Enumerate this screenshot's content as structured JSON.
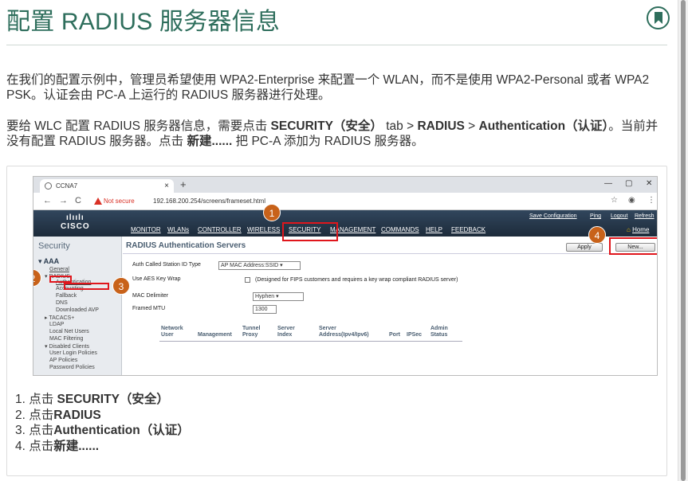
{
  "page": {
    "title": "配置 RADIUS 服务器信息",
    "bookmark_icon": "bookmark-icon"
  },
  "intro": {
    "p1": "在我们的配置示例中，管理员希望使用 WPA2-Enterprise 来配置一个 WLAN，而不是使用 WPA2-Personal 或者 WPA2 PSK。认证会由 PC-A 上运行的 RADIUS 服务器进行处理。",
    "p2_a": "要给 WLC 配置 RADIUS 服务器信息，需要点击 ",
    "p2_security": "SECURITY（安全）",
    "p2_b": " tab > ",
    "p2_radius": "RADIUS",
    "p2_c": " > ",
    "p2_auth": "Authentication（认证）",
    "p2_d": "。当前并没有配置 RADIUS 服务器。点击 ",
    "p2_new": "新建......",
    "p2_e": " 把 PC-A 添加为 RADIUS 服务器。"
  },
  "browser": {
    "tab_title": "CCNA7",
    "tab_close": "×",
    "new_tab": "+",
    "win_min": "—",
    "win_max": "▢",
    "win_close": "✕",
    "back": "←",
    "forward": "→",
    "reload": "C",
    "not_secure": "Not secure",
    "url": "192.168.200.254/screens/frameset.html",
    "star": "☆",
    "account": "◉",
    "more": "⋮"
  },
  "wlc": {
    "logo_top": "ılıılı",
    "logo_bottom": "CISCO",
    "menu": [
      "MONITOR",
      "WLANs",
      "CONTROLLER",
      "WIRELESS",
      "SECURITY",
      "MANAGEMENT",
      "COMMANDS",
      "HELP",
      "FEEDBACK"
    ],
    "top_links": [
      "Save Configuration",
      "Ping",
      "Logout",
      "Refresh"
    ],
    "home": "Home",
    "sidebar_title": "Security",
    "sidebar": {
      "aaa": "▾ AAA",
      "general": "General",
      "radius": "▾ RADIUS",
      "authentication": "Authentication",
      "accounting": "Accounting",
      "fallback": "Fallback",
      "dns": "DNS",
      "downloaded_avp": "Downloaded AVP",
      "tacacs": "▸ TACACS+",
      "ldap": "LDAP",
      "local_net_users": "Local Net Users",
      "mac_filtering": "MAC Filtering",
      "disabled_clients": "▾ Disabled Clients",
      "user_login_policies": "User Login Policies",
      "ap_policies": "AP Policies",
      "password_policies": "Password Policies"
    },
    "content_title": "RADIUS Authentication Servers",
    "apply_label": "Apply",
    "new_label": "New...",
    "auth_called_label": "Auth Called Station ID Type",
    "auth_called_value": "AP MAC Address:SSID ▾",
    "aes_label": "Use AES Key Wrap",
    "aes_note": "(Designed for FIPS customers and requires a key wrap compliant RADIUS server)",
    "mac_delim_label": "MAC Delimiter",
    "mac_delim_value": "Hyphen ▾",
    "mtu_label": "Framed MTU",
    "mtu_value": "1300",
    "table_headers": {
      "network_user": "Network User",
      "management": "Management",
      "tunnel_proxy": "Tunnel Proxy",
      "server_index": "Server Index",
      "server_address": "Server Address(Ipv4/Ipv6)",
      "port": "Port",
      "ipsec": "IPSec",
      "admin_status": "Admin Status"
    },
    "badges": [
      "1",
      "2",
      "3",
      "4"
    ]
  },
  "steps": {
    "s1_pre": "1. 点击 ",
    "s1_b": "SECURITY（安全）",
    "s2_pre": "2. 点击",
    "s2_b": "RADIUS",
    "s3_pre": "3. 点击",
    "s3_b": "Authentication（认证）",
    "s4_pre": "4. 点击",
    "s4_b": "新建......"
  },
  "colors": {
    "title_green": "#2e6e5c",
    "badge_orange": "#c8621a",
    "highlight_red": "#e0161c",
    "cisco_bar": "#1d2b3a"
  }
}
